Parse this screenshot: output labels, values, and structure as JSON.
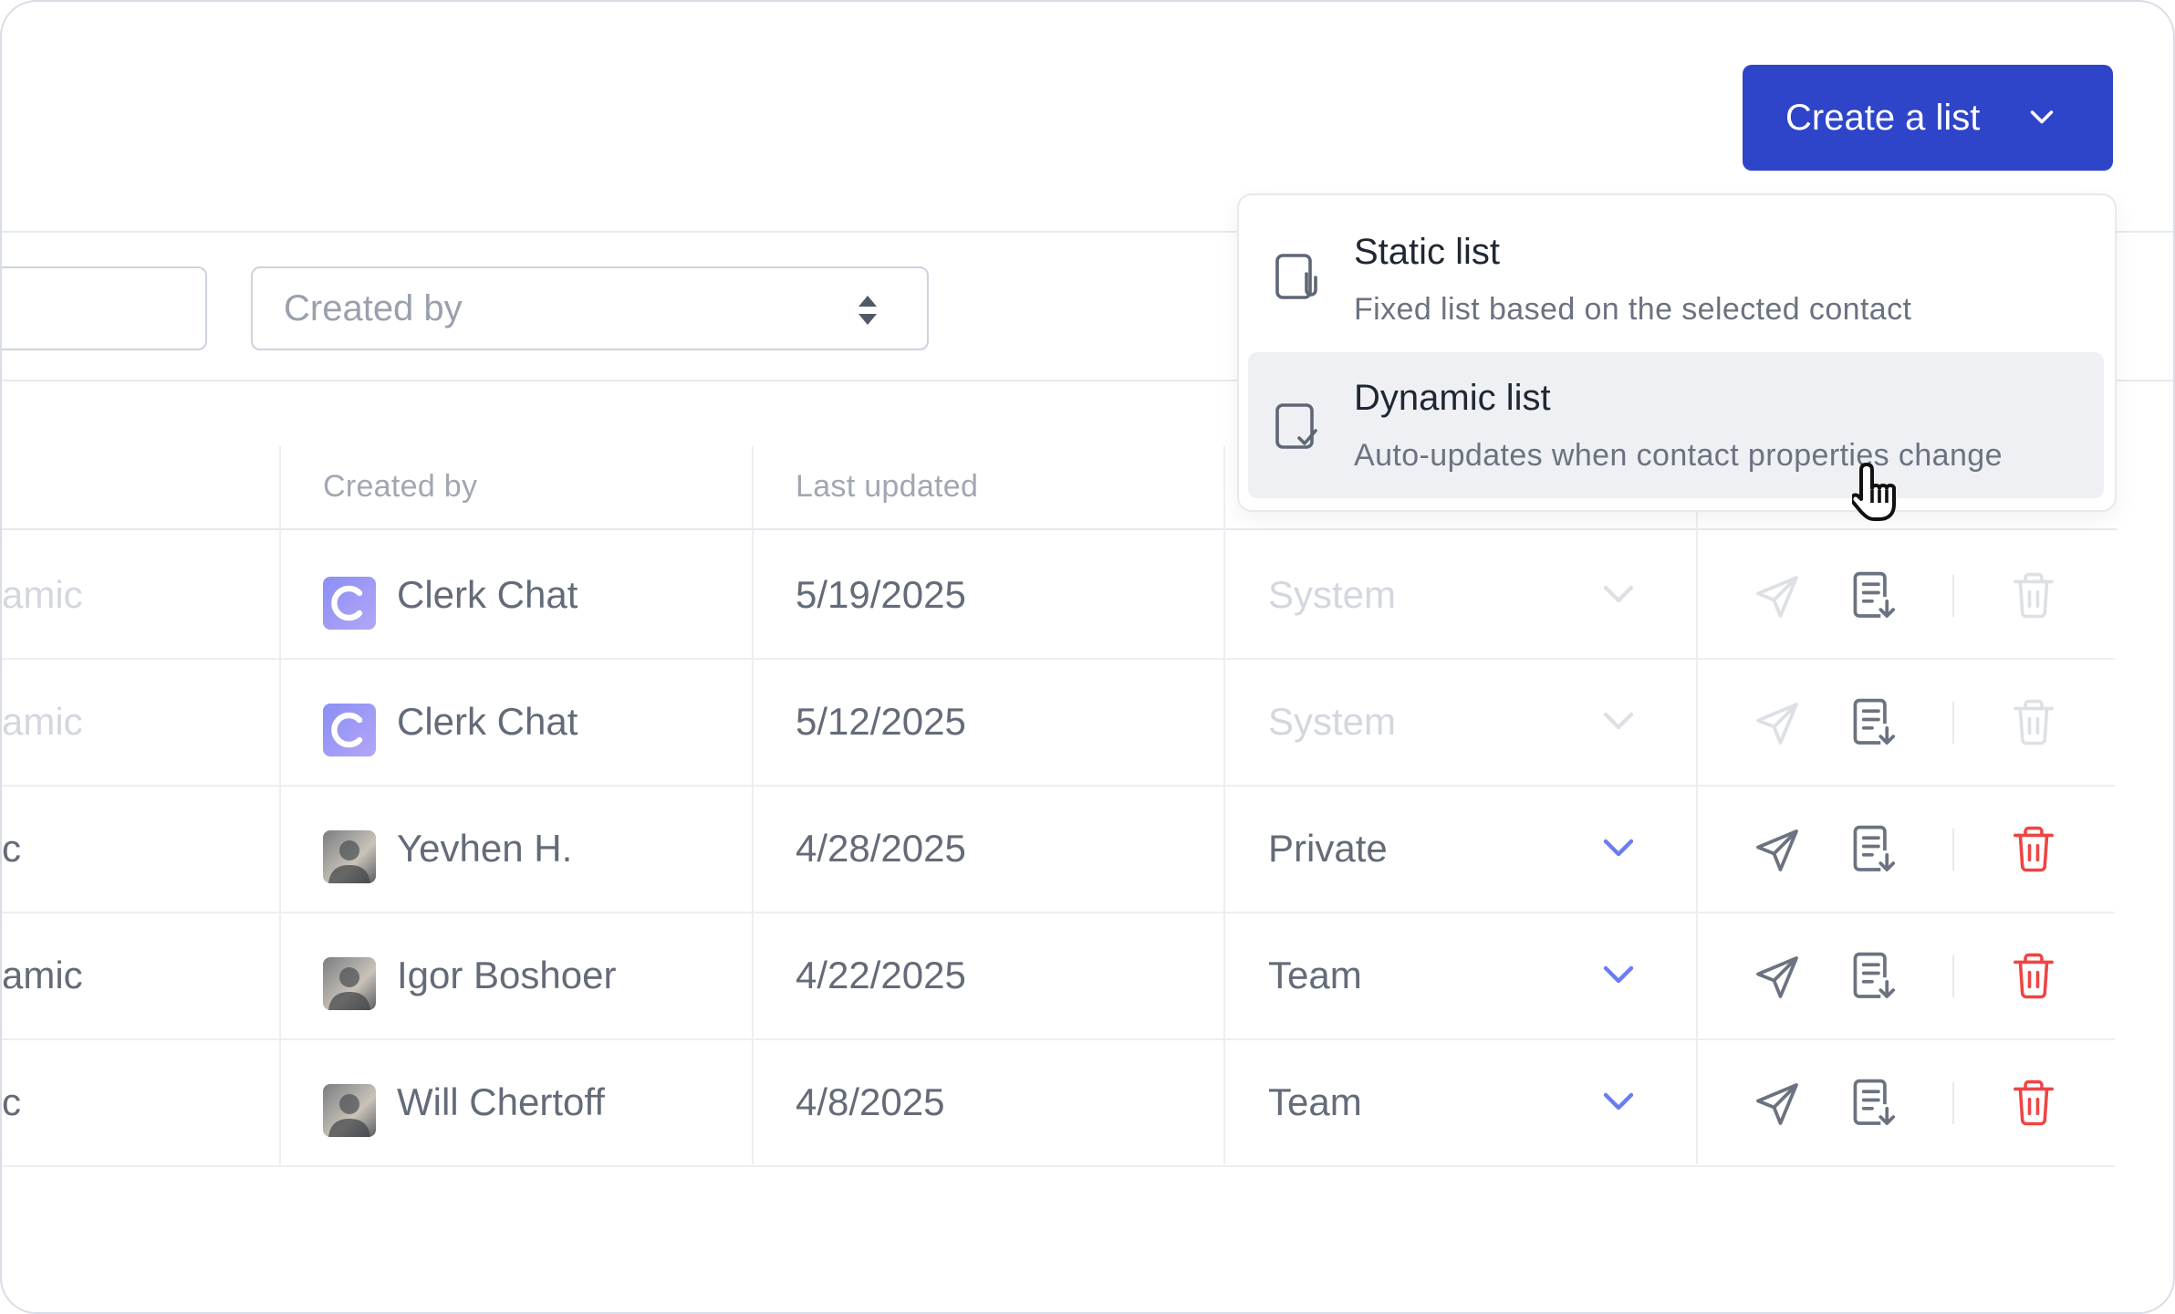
{
  "header": {
    "create_button_label": "Create a list"
  },
  "filters": {
    "created_by_placeholder": "Created by"
  },
  "table": {
    "columns": [
      "Created by",
      "Last updated"
    ],
    "rows": [
      {
        "type_fragment": "amic",
        "creator": "Clerk Chat",
        "avatar": "clerk-chat-logo",
        "updated": "5/19/2025",
        "visibility": "System",
        "enabled": false
      },
      {
        "type_fragment": "amic",
        "creator": "Clerk Chat",
        "avatar": "clerk-chat-logo",
        "updated": "5/12/2025",
        "visibility": "System",
        "enabled": false
      },
      {
        "type_fragment": "c",
        "creator": "Yevhen H.",
        "avatar": "user-photo",
        "updated": "4/28/2025",
        "visibility": "Private",
        "enabled": true
      },
      {
        "type_fragment": "amic",
        "creator": "Igor Boshoer",
        "avatar": "user-photo",
        "updated": "4/22/2025",
        "visibility": "Team",
        "enabled": true
      },
      {
        "type_fragment": "c",
        "creator": "Will Chertoff",
        "avatar": "user-photo",
        "updated": "4/8/2025",
        "visibility": "Team",
        "enabled": true
      }
    ]
  },
  "menu": {
    "items": [
      {
        "title": "Static list",
        "description": "Fixed list based on the selected contact",
        "icon": "paperclip-document-icon"
      },
      {
        "title": "Dynamic list",
        "description": "Auto-updates when contact properties change",
        "icon": "check-document-icon"
      }
    ]
  },
  "colors": {
    "primary": "#2e44c9",
    "danger": "#ef4444",
    "accent_chevron": "#6b7cf0"
  }
}
